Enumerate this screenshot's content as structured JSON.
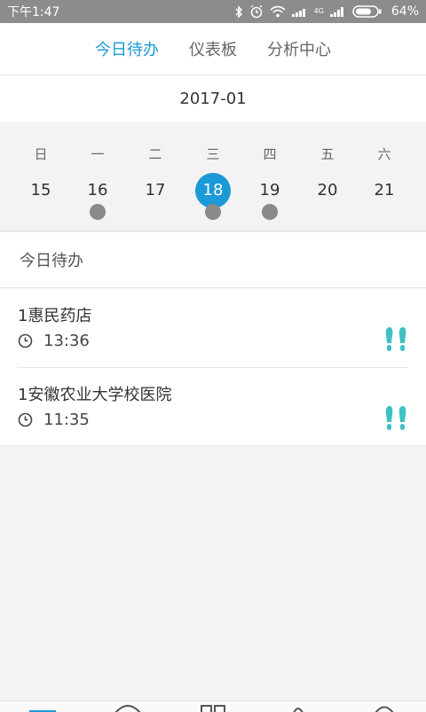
{
  "status_bar": {
    "time": "下午1:47",
    "network_label": "4G",
    "battery_pct": "64%",
    "icons": [
      "bluetooth-icon",
      "alarm-icon",
      "wifi-icon",
      "signal-icon",
      "signal-icon",
      "battery-icon"
    ]
  },
  "tabs": [
    {
      "label": "今日待办",
      "active": true
    },
    {
      "label": "仪表板",
      "active": false
    },
    {
      "label": "分析中心",
      "active": false
    }
  ],
  "calendar": {
    "month": "2017-01",
    "weekdays": [
      "日",
      "一",
      "二",
      "三",
      "四",
      "五",
      "六"
    ],
    "dates": [
      "15",
      "16",
      "17",
      "18",
      "19",
      "20",
      "21"
    ],
    "selected": "18",
    "dots_on": [
      "16",
      "18",
      "19"
    ]
  },
  "todo": {
    "header": "今日待办",
    "items": [
      {
        "name": "1惠民药店",
        "time": "13:36",
        "icon": "footprints-icon"
      },
      {
        "name": "1安徽农业大学校医院",
        "time": "11:35",
        "icon": "footprints-icon"
      }
    ]
  },
  "bottom_nav": {
    "icons": [
      "home-icon",
      "compass-icon",
      "apps-icon",
      "contacts-icon",
      "profile-icon"
    ]
  },
  "colors": {
    "accent": "#1a9ad6",
    "footprints": "#3ec1c3",
    "status_bar": "#8c8c8c",
    "dot": "#8a8a8a"
  }
}
